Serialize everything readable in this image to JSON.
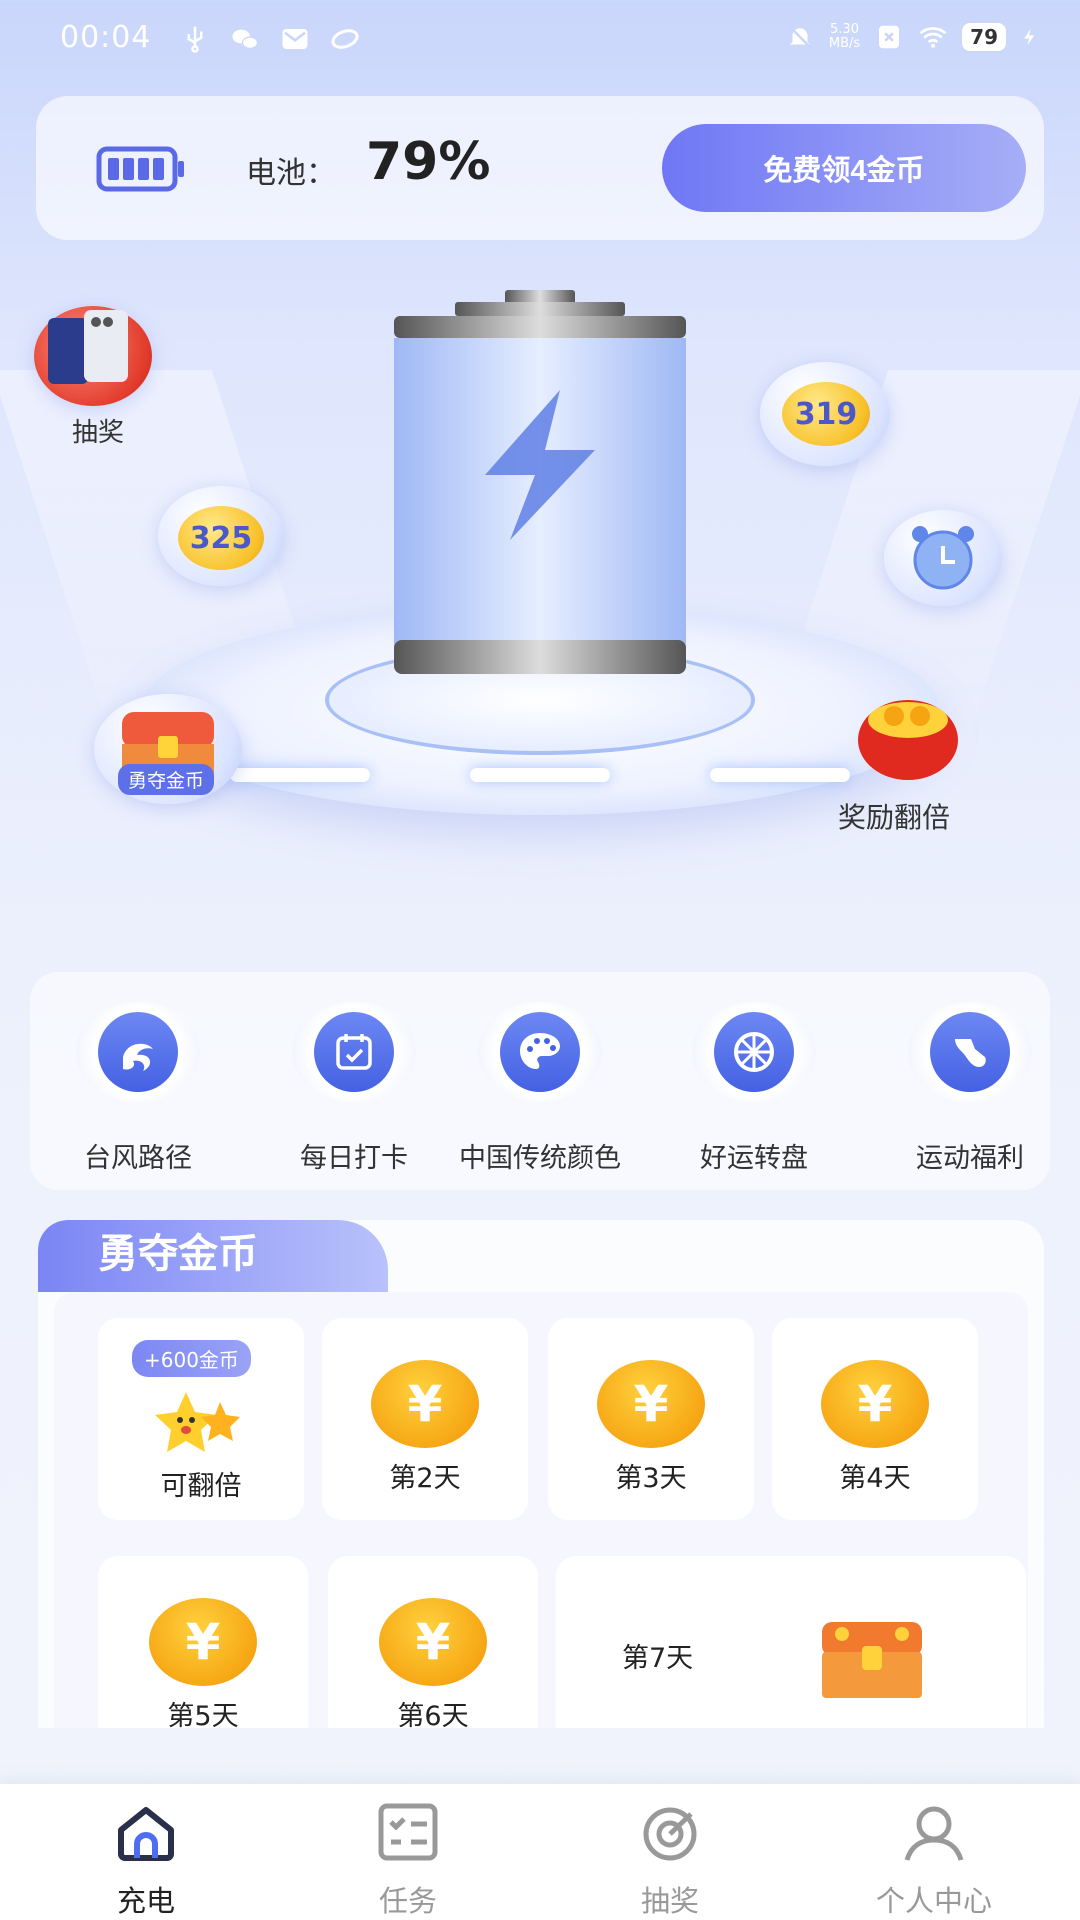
{
  "status_bar": {
    "time": "00:04",
    "net_speed_value": "5.30",
    "net_speed_unit": "MB/s",
    "battery_level": "79"
  },
  "battery_card": {
    "label": "电池：",
    "value": "79%",
    "free_coin_button": "免费领4金币"
  },
  "hero": {
    "lottery_label": "抽奖",
    "coin_left": "325",
    "coin_right": "319",
    "chest_badge": "勇夺金币",
    "double_reward_label": "奖励翻倍"
  },
  "quick_actions": [
    {
      "label": "台风路径",
      "icon": "typhoon-icon"
    },
    {
      "label": "每日打卡",
      "icon": "calendar-check-icon"
    },
    {
      "label": "中国传统颜色",
      "icon": "palette-icon"
    },
    {
      "label": "好运转盘",
      "icon": "wheel-icon"
    },
    {
      "label": "运动福利",
      "icon": "shoe-icon"
    }
  ],
  "coin_section": {
    "title": "勇夺金币",
    "day1_badge": "+600金币",
    "day1_label": "可翻倍",
    "days": [
      "第2天",
      "第3天",
      "第4天",
      "第5天",
      "第6天"
    ],
    "day7_label": "第7天",
    "yen_symbol": "¥"
  },
  "bottom_nav": [
    {
      "label": "充电",
      "icon": "home-icon",
      "active": true
    },
    {
      "label": "任务",
      "icon": "task-list-icon",
      "active": false
    },
    {
      "label": "抽奖",
      "icon": "lottery-icon",
      "active": false
    },
    {
      "label": "个人中心",
      "icon": "profile-icon",
      "active": false
    }
  ],
  "colors": {
    "accent": "#6f77f5",
    "coin_gold": "#f6a412",
    "background": "#e9eefd"
  }
}
